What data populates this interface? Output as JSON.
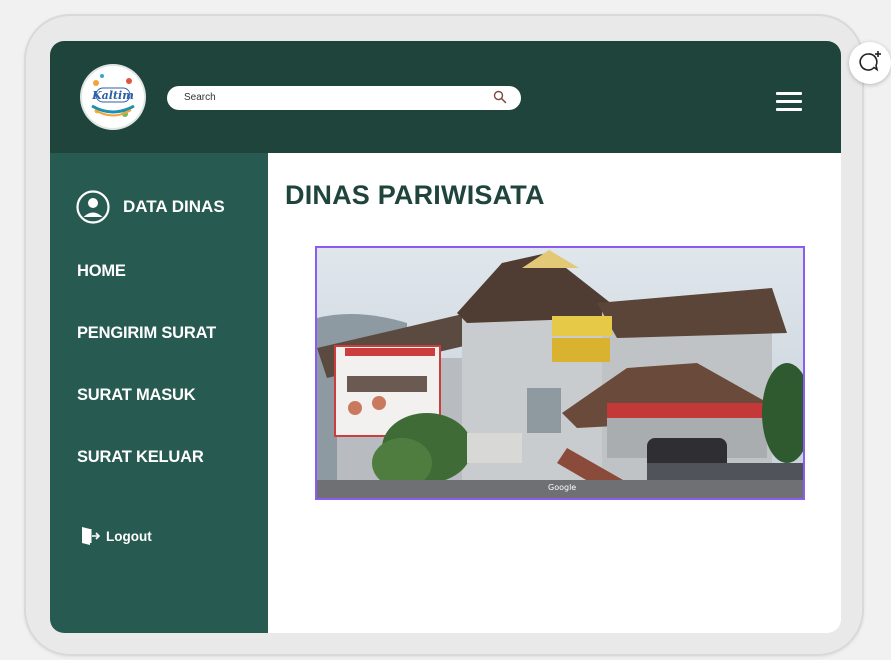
{
  "header": {
    "logo_text": "Kaltim",
    "search_placeholder": "Search"
  },
  "sidebar": {
    "title": "DATA DINAS",
    "items": [
      {
        "label": "HOME"
      },
      {
        "label": "PENGIRIM SURAT"
      },
      {
        "label": "SURAT MASUK"
      },
      {
        "label": "SURAT KELUAR"
      }
    ],
    "logout_label": "Logout"
  },
  "main": {
    "title": "DINAS PARIWISATA",
    "photo_caption": "Google"
  },
  "icons": {
    "search": "search-icon",
    "menu": "hamburger-menu-icon",
    "user": "user-circle-icon",
    "logout": "logout-door-icon",
    "fab": "chat-add-icon"
  },
  "colors": {
    "header_bg": "#1f443c",
    "sidebar_bg": "#275a50",
    "title_text": "#1f443c",
    "image_border": "#8a5cf0"
  }
}
